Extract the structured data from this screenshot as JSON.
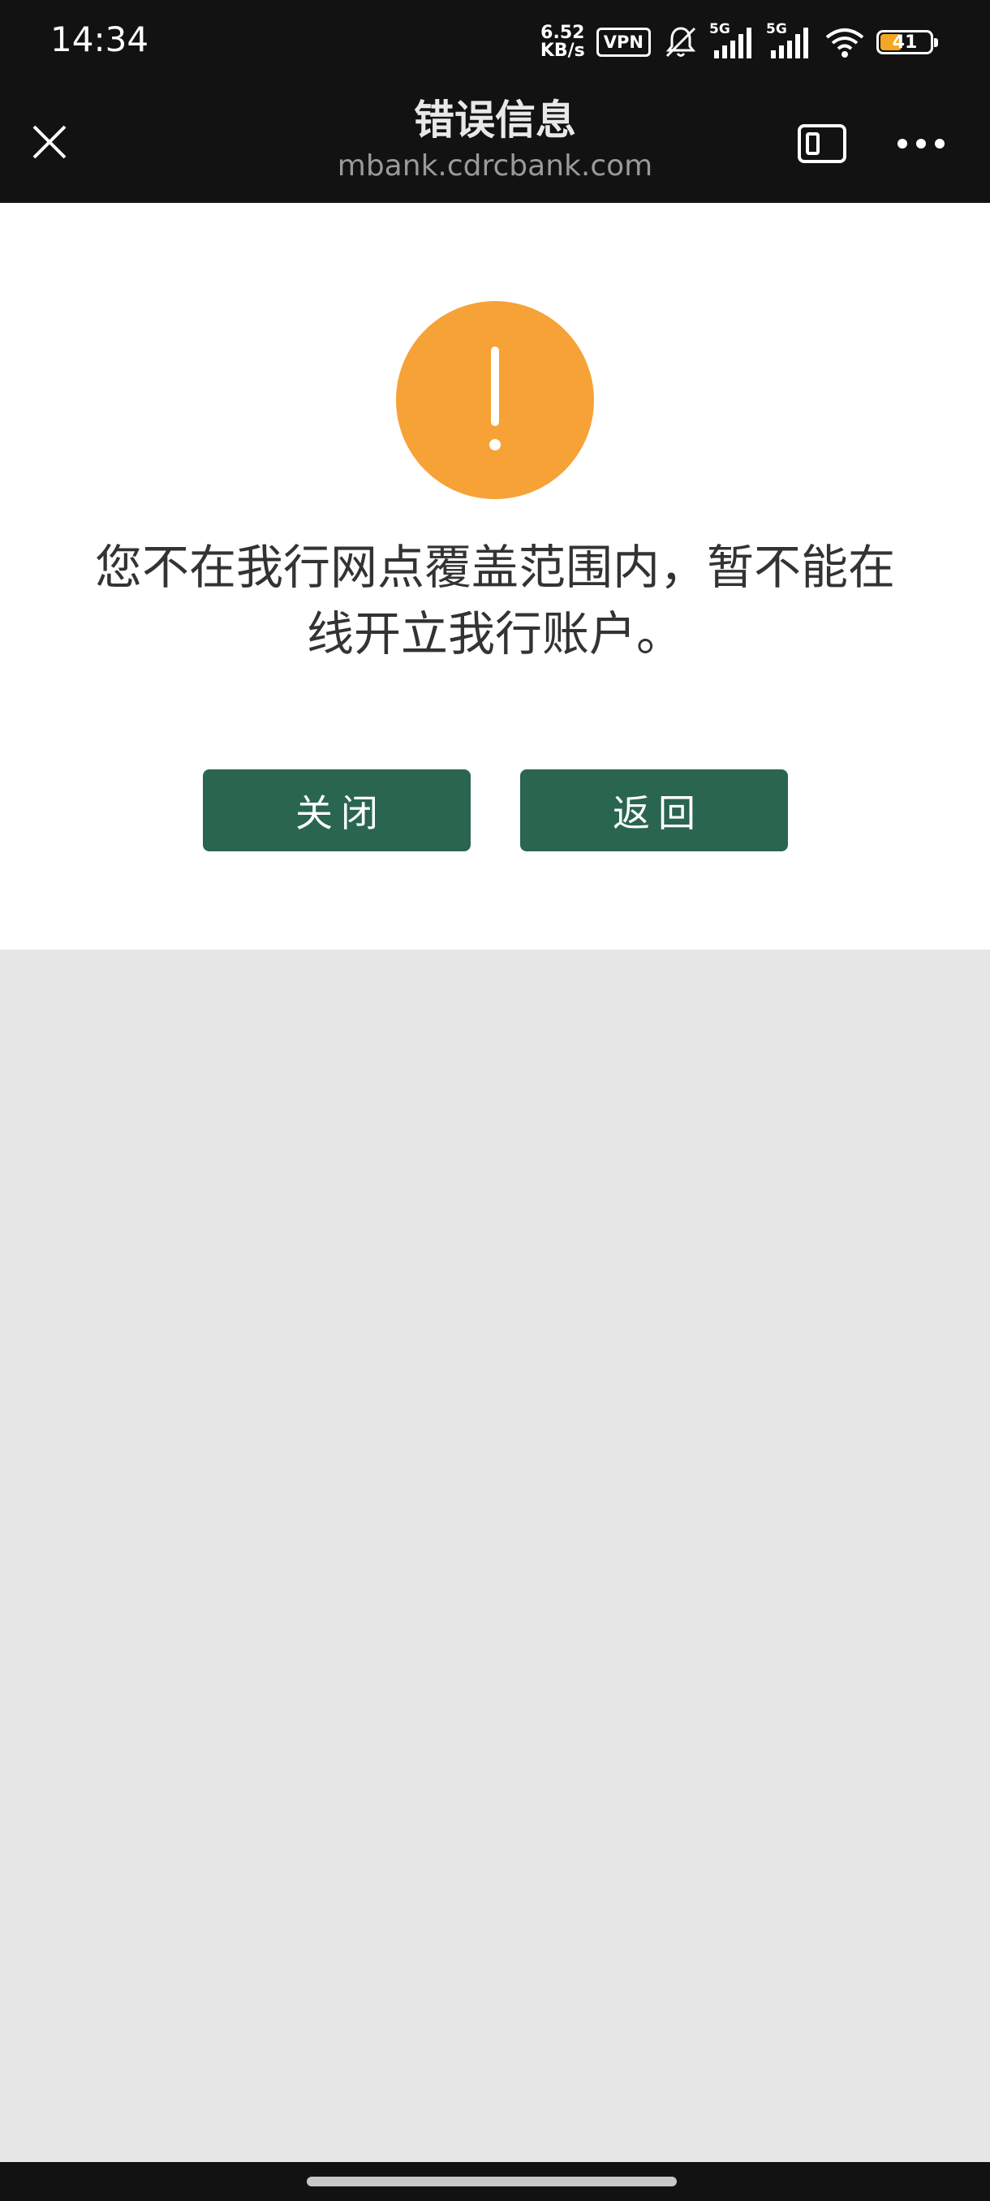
{
  "status_bar": {
    "time": "14:34",
    "net_speed_value": "6.52",
    "net_speed_unit": "KB/s",
    "vpn": "VPN",
    "sim1_label": "5G",
    "sim2_label": "5G",
    "battery_level": "41"
  },
  "header": {
    "title": "错误信息",
    "url": "mbank.cdrcbank.com"
  },
  "content": {
    "message": "您不在我行网点覆盖范围内，暂不能在线开立我行账户。",
    "buttons": {
      "close_label": "关闭",
      "back_label": "返回"
    }
  },
  "colors": {
    "warning": "#f7a236",
    "button": "#2a6550",
    "top_bar": "#121212",
    "page_bg": "#e6e6e6"
  },
  "icons": {
    "close": "close-icon",
    "window": "window-icon",
    "more": "more-icon",
    "warning": "warning-icon"
  }
}
